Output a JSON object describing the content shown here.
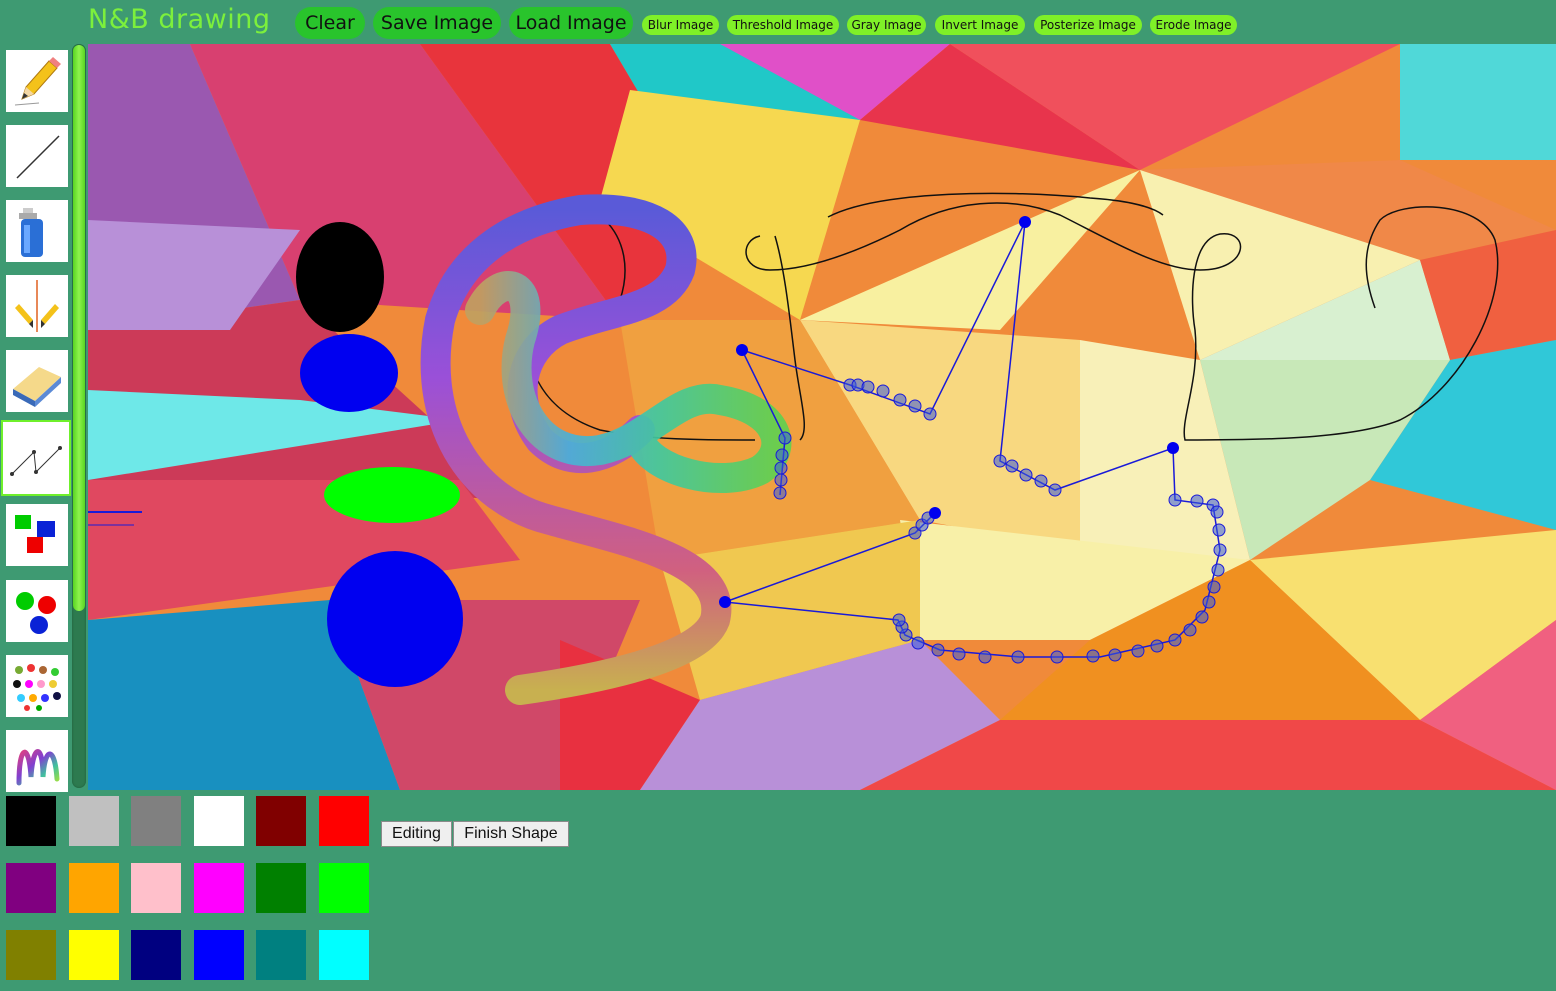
{
  "app": {
    "title": "N&B drawing"
  },
  "top_buttons": {
    "clear": "Clear",
    "save_image": "Save Image",
    "load_image": "Load Image",
    "blur_image": "Blur Image",
    "threshold_image": "Threshold Image",
    "gray_image": "Gray Image",
    "invert_image": "Invert Image",
    "posterize_image": "Posterize Image",
    "erode_image": "Erode Image"
  },
  "tools": [
    {
      "icon": "pencil-icon"
    },
    {
      "icon": "line-icon"
    },
    {
      "icon": "spray-can-icon"
    },
    {
      "icon": "mirror-pencil-icon"
    },
    {
      "icon": "eraser-icon"
    },
    {
      "icon": "vertex-shape-icon",
      "selected": true
    },
    {
      "icon": "rectangles-icon"
    },
    {
      "icon": "circles-icon"
    },
    {
      "icon": "stars-icon"
    },
    {
      "icon": "gradient-brush-icon"
    }
  ],
  "palette": {
    "colors": [
      "#000000",
      "#c0c0c0",
      "#808080",
      "#ffffff",
      "#800000",
      "#ff0000",
      "#800080",
      "#ffa500",
      "#ffc0cb",
      "#ff00ff",
      "#008000",
      "#00ff00",
      "#808000",
      "#ffff00",
      "#000080",
      "#0000ff",
      "#008080",
      "#00ffff"
    ]
  },
  "shape_controls": {
    "editing": "Editing",
    "finish_shape": "Finish Shape"
  },
  "colors": {
    "background": "#3e9a72",
    "title_text": "#7cf03c",
    "primary_button": "#29c42c",
    "filter_button": "#7ff028",
    "selection_outline": "#6ff02b"
  }
}
